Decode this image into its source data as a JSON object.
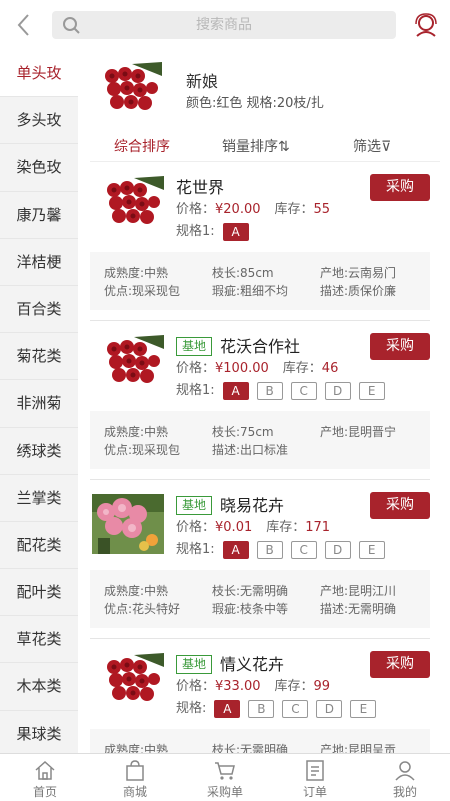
{
  "header": {
    "back_icon": "chevron-left-icon",
    "search_placeholder": "搜索商品",
    "search_icon": "search-icon",
    "person_icon": "customer-service-icon"
  },
  "sidebar": {
    "items": [
      {
        "label": "单头玫",
        "active": true
      },
      {
        "label": "多头玫"
      },
      {
        "label": "染色玫"
      },
      {
        "label": "康乃馨"
      },
      {
        "label": "洋桔梗"
      },
      {
        "label": "百合类"
      },
      {
        "label": "菊花类"
      },
      {
        "label": "非洲菊"
      },
      {
        "label": "绣球类"
      },
      {
        "label": "兰掌类"
      },
      {
        "label": "配花类"
      },
      {
        "label": "配叶类"
      },
      {
        "label": "草花类"
      },
      {
        "label": "木本类"
      },
      {
        "label": "果球类"
      }
    ]
  },
  "category": {
    "title": "新娘",
    "subtitle": "颜色:红色   规格:20枝/扎"
  },
  "sort": {
    "overall": "综合排序",
    "sales": "销量排序⇅",
    "filter": "筛选⊽"
  },
  "labels": {
    "price": "价格：",
    "stock": "库存：",
    "spec": "规格1:",
    "spec_alt": "规格:",
    "buy": "采购",
    "base": "基地"
  },
  "products": [
    {
      "name": "花世界",
      "base": false,
      "price": "¥20.00",
      "stock": "55",
      "spec_label": "规格1:",
      "specs": [
        "A"
      ],
      "attrs": [
        "成熟度:中熟",
        "枝长:85cm",
        "产地:云南易门",
        "优点:现采现包",
        "瑕疵:粗细不均",
        "描述:质保价廉"
      ]
    },
    {
      "name": "花沃合作社",
      "base": true,
      "price": "¥100.00",
      "stock": "46",
      "spec_label": "规格1:",
      "specs": [
        "A",
        "B",
        "C",
        "D",
        "E"
      ],
      "attrs": [
        "成熟度:中熟",
        "枝长:75cm",
        "产地:昆明晋宁",
        "优点:现采现包",
        "描述:出口标准",
        ""
      ]
    },
    {
      "name": "晓易花卉",
      "base": true,
      "price": "¥0.01",
      "stock": "171",
      "spec_label": "规格1:",
      "specs": [
        "A",
        "B",
        "C",
        "D",
        "E"
      ],
      "attrs": [
        "成熟度:中熟",
        "枝长:无需明确",
        "产地:昆明江川",
        "优点:花头特好",
        "瑕疵:枝条中等",
        "描述:无需明确"
      ]
    },
    {
      "name": "情义花卉",
      "base": true,
      "price": "¥33.00",
      "stock": "99",
      "spec_label": "规格:",
      "specs": [
        "A",
        "B",
        "C",
        "D",
        "E"
      ],
      "attrs": [
        "成熟度:中熟",
        "枝长:无需明确",
        "产地:昆明呈贡",
        "",
        "",
        ""
      ]
    }
  ],
  "tabbar": [
    {
      "label": "首页",
      "icon": "home-icon"
    },
    {
      "label": "商城",
      "icon": "shopping-bag-icon"
    },
    {
      "label": "采购单",
      "icon": "cart-icon"
    },
    {
      "label": "订单",
      "icon": "order-list-icon"
    },
    {
      "label": "我的",
      "icon": "user-icon"
    }
  ],
  "colors": {
    "accent": "#a8232c",
    "base_badge": "#3a9a3a",
    "sidebar_bg": "#f3f3f3"
  }
}
